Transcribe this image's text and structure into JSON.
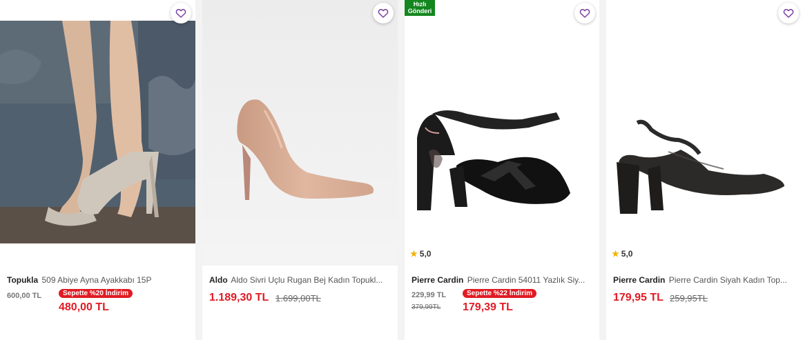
{
  "products": [
    {
      "brand": "Topukla",
      "name": "509 Abiye Ayna Ayakkabı 15P",
      "list_price": "600,00 TL",
      "basket_discount": "Sepette %20 İndirim",
      "final_price": "480,00 TL"
    },
    {
      "brand": "Aldo",
      "name": "Aldo Sivri Uçlu Rugan Bej Kadın Topukl...",
      "price": "1.189,30 TL",
      "old_price": "1.699,00TL"
    },
    {
      "brand": "Pierre Cardin",
      "name": "Pierre Cardin 54011 Yazlık Siy...",
      "badge": "Hızlı Gönderi",
      "rating": "5,0",
      "price": "229,99 TL",
      "old_price": "379,99TL",
      "basket_discount": "Sepette %22 İndirim",
      "final_price": "179,39 TL"
    },
    {
      "brand": "Pierre Cardin",
      "name": "Pierre Cardin Siyah Kadın Top...",
      "rating": "5,0",
      "price": "179,95 TL",
      "old_price": "259,95TL"
    }
  ],
  "colors": {
    "discount_red": "#e01b24",
    "fast_delivery_green": "#14861f",
    "favorite_purple": "#7b3fa0",
    "star_yellow": "#f2b100"
  },
  "icons": {
    "favorite": "heart-outline-icon",
    "rating": "star-icon"
  }
}
